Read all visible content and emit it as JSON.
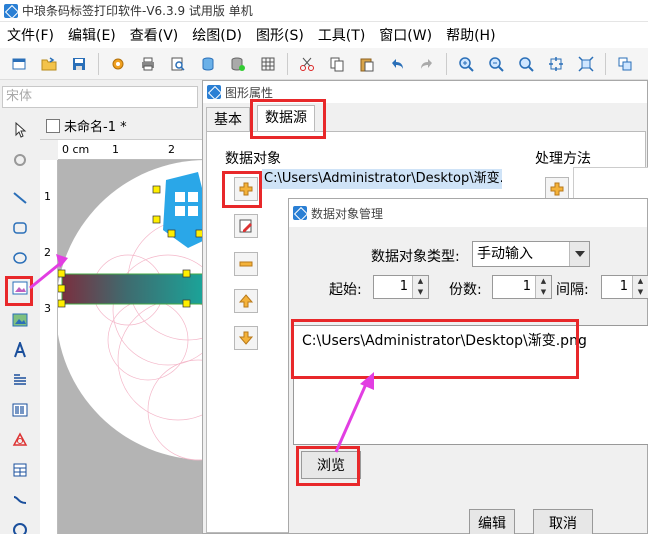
{
  "app": {
    "title": "中琅条码标签打印软件-V6.3.9 试用版 单机"
  },
  "menu": [
    "文件(F)",
    "编辑(E)",
    "查看(V)",
    "绘图(D)",
    "图形(S)",
    "工具(T)",
    "窗口(W)",
    "帮助(H)"
  ],
  "toolbar": {
    "icons": [
      "new-icon",
      "open-icon",
      "save-icon",
      "settings-icon",
      "print-icon",
      "print-preview-icon",
      "database-icon",
      "database-connect-icon",
      "grid-icon",
      "cut-icon",
      "copy-icon",
      "paste-icon",
      "undo-icon",
      "redo-icon",
      "zoom-in-icon",
      "zoom-out-icon",
      "zoom-fit-icon",
      "fit-window-icon",
      "fit-page-icon",
      "layers-icon"
    ]
  },
  "font": {
    "placeholder": "宋体"
  },
  "document": {
    "tab_name": "未命名-1 *",
    "ruler_label": "0 cm",
    "ruler_marks": [
      "1",
      "2",
      "3"
    ]
  },
  "left_tools": [
    "select-icon",
    "rotate-icon",
    "line-icon",
    "rectangle-icon",
    "ellipse-icon",
    "picture-icon",
    "image-icon",
    "text-icon",
    "rich-text-icon",
    "barcode-icon",
    "shape-icon",
    "table-icon",
    "curve-icon",
    "circle-icon"
  ],
  "shape_props": {
    "title": "图形属性",
    "tabs": [
      "基本",
      "数据源"
    ],
    "data_object_label": "数据对象",
    "processing_label": "处理方法",
    "data_path": "C:\\Users\\Administrator\\Desktop\\渐变.p"
  },
  "data_manager": {
    "title": "数据对象管理",
    "type_label": "数据对象类型:",
    "type_value": "手动输入",
    "start_label": "起始:",
    "start_value": "1",
    "copies_label": "份数:",
    "copies_value": "1",
    "interval_label": "间隔:",
    "interval_value": "1",
    "content": "C:\\Users\\Administrator\\Desktop\\渐变.png",
    "browse_label": "浏览",
    "edit_label": "编辑",
    "cancel_label": "取消"
  }
}
